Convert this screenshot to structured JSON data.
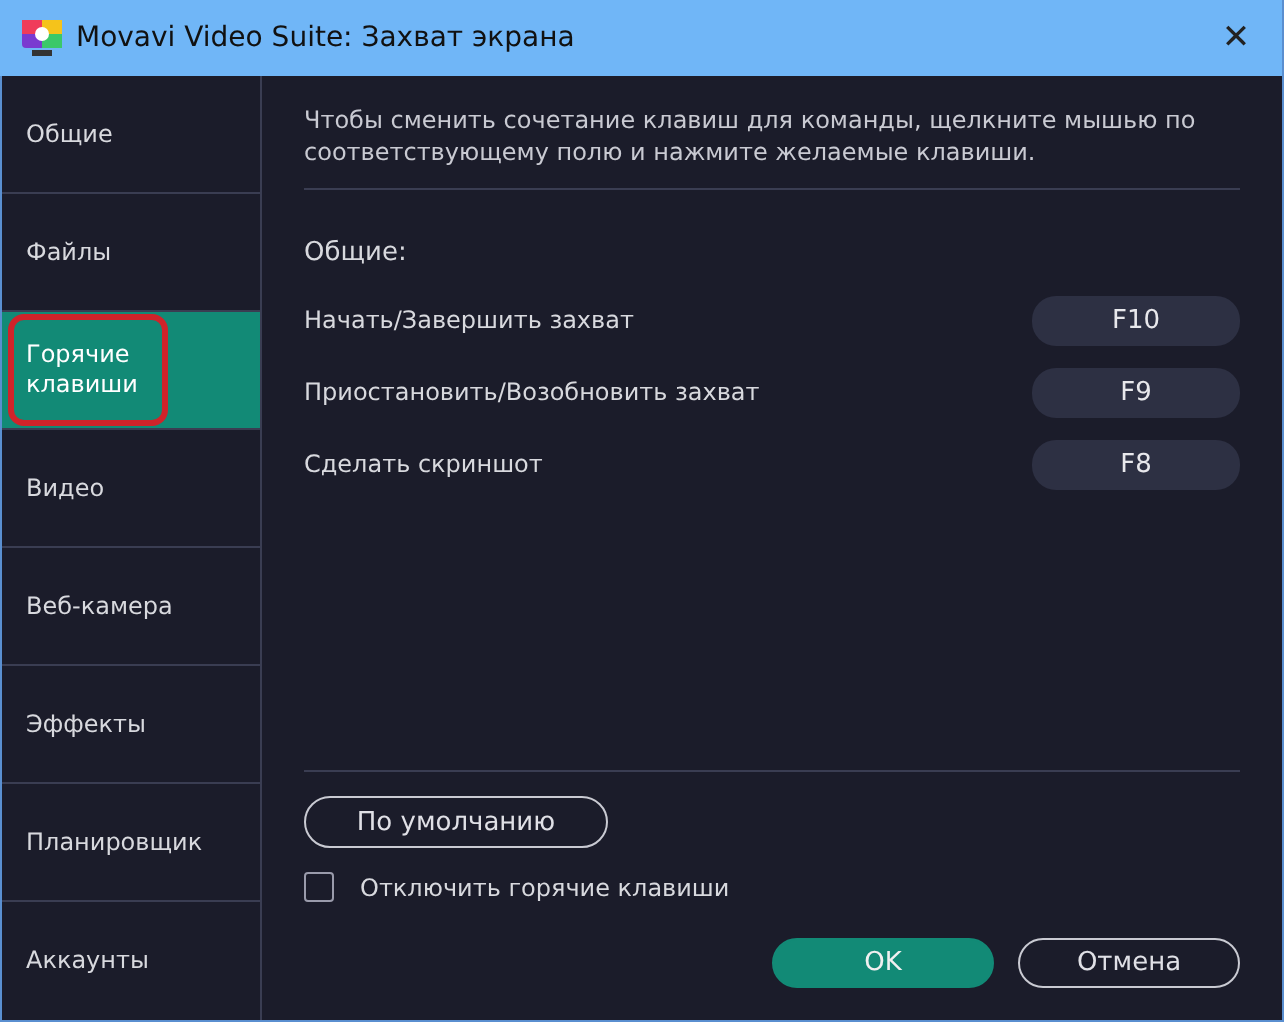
{
  "window": {
    "title": "Movavi Video Suite: Захват экрана",
    "close": "✕"
  },
  "sidebar": {
    "items": [
      {
        "label": "Общие",
        "selected": false,
        "highlighted": false
      },
      {
        "label": "Файлы",
        "selected": false,
        "highlighted": false
      },
      {
        "label": "Горячие клавиши",
        "selected": true,
        "highlighted": true
      },
      {
        "label": "Видео",
        "selected": false,
        "highlighted": false
      },
      {
        "label": "Веб-камера",
        "selected": false,
        "highlighted": false
      },
      {
        "label": "Эффекты",
        "selected": false,
        "highlighted": false
      },
      {
        "label": "Планировщик",
        "selected": false,
        "highlighted": false
      },
      {
        "label": "Аккаунты",
        "selected": false,
        "highlighted": false
      }
    ]
  },
  "content": {
    "hint": "Чтобы сменить сочетание клавиш для команды, щелкните мышью по соответствующему полю и нажмите желаемые клавиши.",
    "section": "Общие:",
    "hotkeys": [
      {
        "action": "Начать/Завершить захват",
        "key": "F10"
      },
      {
        "action": "Приостановить/Возобновить захват",
        "key": "F9"
      },
      {
        "action": "Сделать скриншот",
        "key": "F8"
      }
    ],
    "default_button": "По умолчанию",
    "disable_hotkeys": {
      "label": "Отключить горячие клавиши",
      "checked": false
    }
  },
  "buttons": [
    {
      "label": "OK",
      "kind": "primary"
    },
    {
      "label": "Отмена",
      "kind": "secondary"
    }
  ]
}
